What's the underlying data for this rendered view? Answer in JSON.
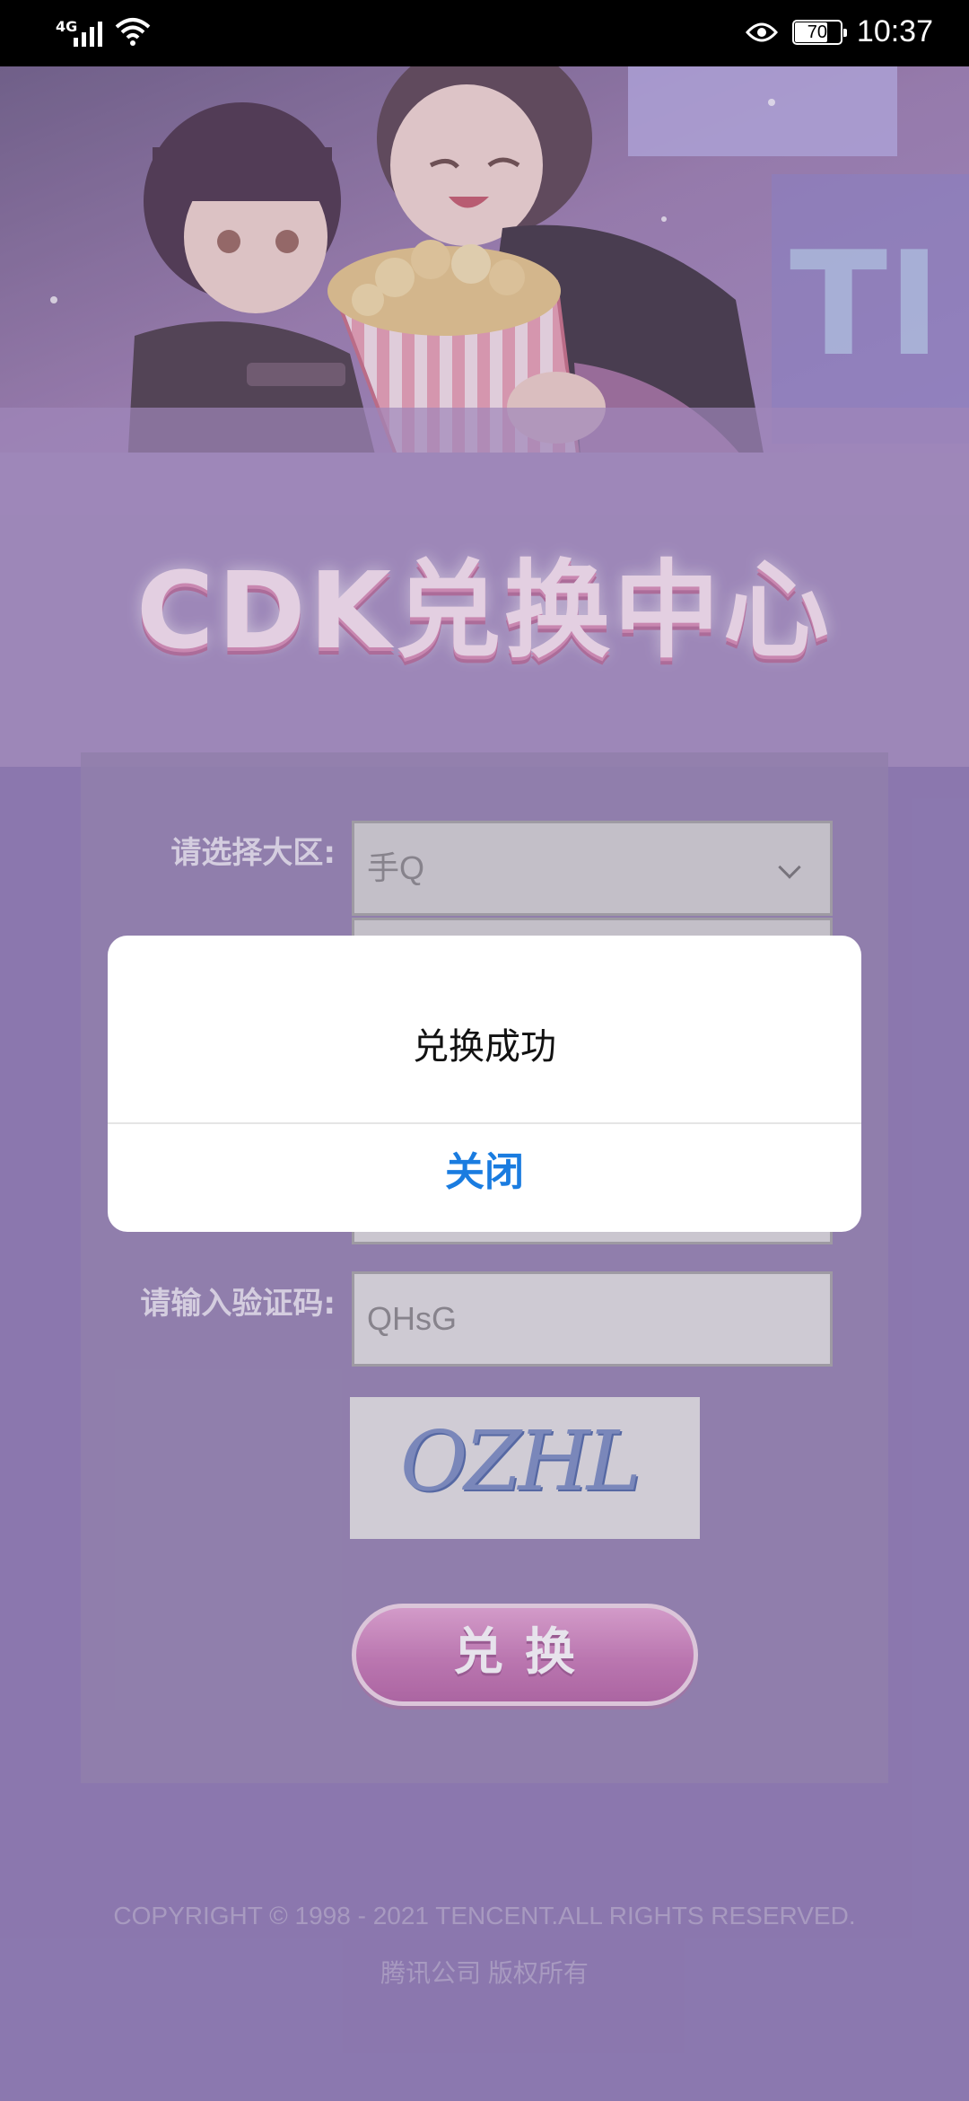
{
  "status_bar": {
    "network": "4G",
    "battery": "70",
    "time": "10:37"
  },
  "banner": {
    "title": "CDK兑换中心"
  },
  "form": {
    "region_label": "请选择大区:",
    "region_value": "手Q",
    "captcha_label": "请输入验证码:",
    "captcha_value": "QHsG",
    "captcha_image_text": "OZHL",
    "redeem_button": "兑换"
  },
  "dialog": {
    "message": "兑换成功",
    "close_button": "关闭"
  },
  "footer": {
    "copyright": "COPYRIGHT © 1998 - 2021 TENCENT.ALL RIGHTS RESERVED.",
    "company": "腾讯公司 版权所有"
  }
}
